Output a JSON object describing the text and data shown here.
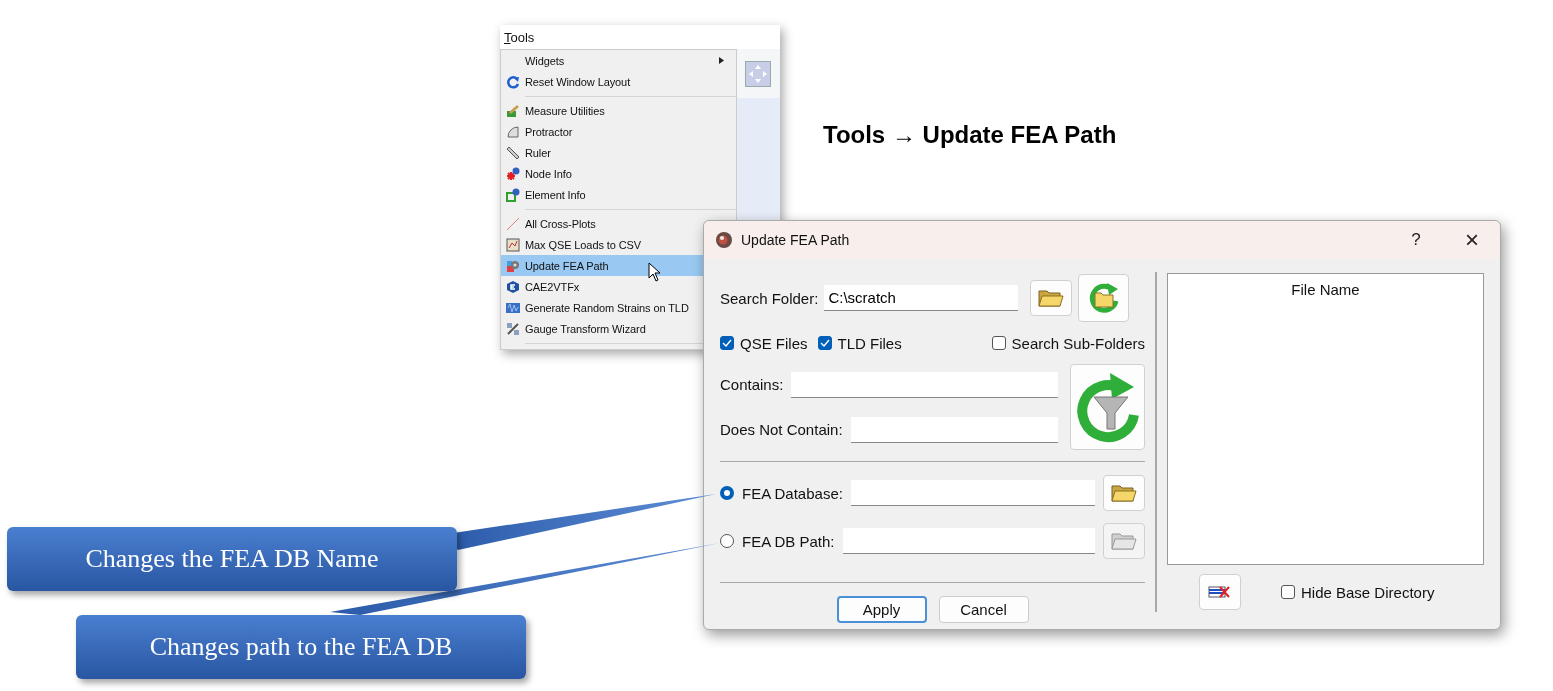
{
  "menu": {
    "title": "Tools",
    "items": [
      {
        "kind": "item",
        "label": "Widgets",
        "submenu": true,
        "selected": false
      },
      {
        "kind": "item",
        "label": "Reset Window Layout",
        "submenu": false,
        "selected": false
      },
      {
        "kind": "separator"
      },
      {
        "kind": "item",
        "label": "Measure Utilities",
        "submenu": false,
        "selected": false
      },
      {
        "kind": "item",
        "label": "Protractor",
        "submenu": false,
        "selected": false
      },
      {
        "kind": "item",
        "label": "Ruler",
        "submenu": false,
        "selected": false
      },
      {
        "kind": "item",
        "label": "Node Info",
        "submenu": false,
        "selected": false
      },
      {
        "kind": "item",
        "label": "Element Info",
        "submenu": false,
        "selected": false
      },
      {
        "kind": "separator"
      },
      {
        "kind": "item",
        "label": "All Cross-Plots",
        "submenu": false,
        "selected": false
      },
      {
        "kind": "item",
        "label": "Max QSE Loads to CSV",
        "submenu": false,
        "selected": false
      },
      {
        "kind": "item",
        "label": "Update FEA Path",
        "submenu": false,
        "selected": true
      },
      {
        "kind": "item",
        "label": "CAE2VTFx",
        "submenu": false,
        "selected": false
      },
      {
        "kind": "item",
        "label": "Generate Random Strains on TLD",
        "submenu": false,
        "selected": false
      },
      {
        "kind": "item",
        "label": "Gauge Transform Wizard",
        "submenu": false,
        "selected": false
      },
      {
        "kind": "separator"
      }
    ]
  },
  "caption": "Tools → Update FEA Path",
  "dialog": {
    "title": "Update FEA Path",
    "help": "?",
    "close": "×",
    "search_folder": {
      "label": "Search Folder:",
      "value": "C:\\scratch"
    },
    "checkboxes": [
      {
        "label": "QSE Files",
        "checked": true
      },
      {
        "label": "TLD Files",
        "checked": true
      },
      {
        "label": "Search Sub-Folders",
        "checked": false
      }
    ],
    "contains": {
      "label": "Contains:"
    },
    "does_not_contain": {
      "label": "Does Not Contain:"
    },
    "radios": [
      {
        "label": "FEA Database:",
        "selected": true
      },
      {
        "label": "FEA DB Path:",
        "selected": false
      }
    ],
    "buttons": [
      "Apply",
      "Cancel"
    ],
    "file_list": {
      "column": "File Name"
    },
    "hide_base_directory": {
      "label": "Hide Base Directory",
      "checked": false
    }
  },
  "callouts": [
    {
      "text": "Changes the FEA DB Name"
    },
    {
      "text": "Changes path to the FEA DB"
    }
  ]
}
